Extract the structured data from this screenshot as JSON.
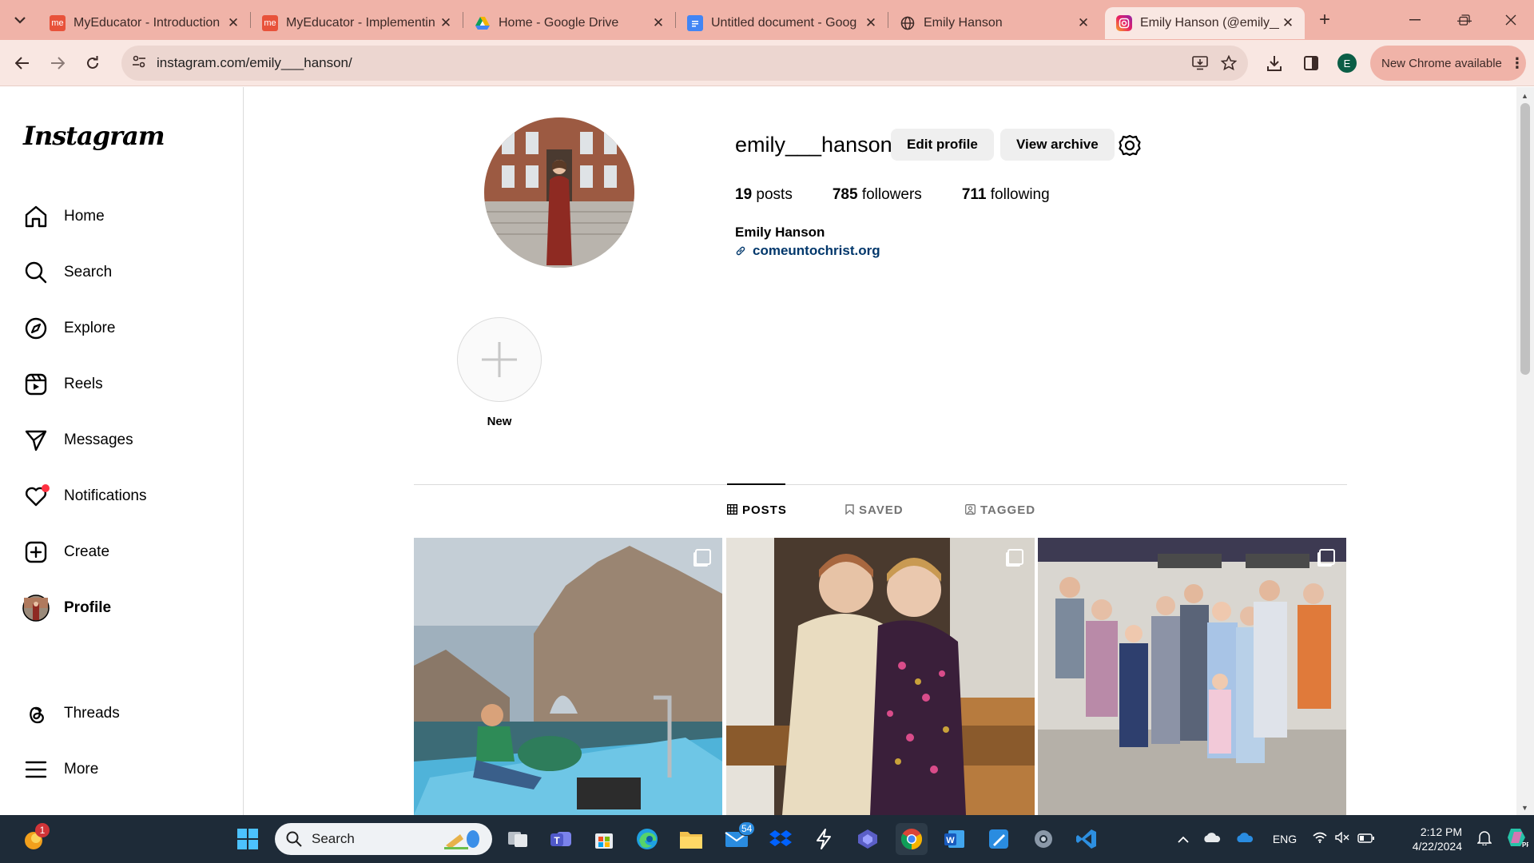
{
  "browser": {
    "tabs": [
      {
        "title": "MyEducator - Introduction",
        "favicon": "myeducator-icon",
        "color": "#e8523a"
      },
      {
        "title": "MyEducator - Implementin",
        "favicon": "myeducator-icon",
        "color": "#e8523a"
      },
      {
        "title": "Home - Google Drive",
        "favicon": "google-drive-icon"
      },
      {
        "title": "Untitled document - Goog",
        "favicon": "google-docs-icon",
        "color": "#4285f4"
      },
      {
        "title": "Emily Hanson",
        "favicon": "globe-icon"
      },
      {
        "title": "Emily Hanson (@emily__h",
        "favicon": "instagram-icon",
        "active": true
      }
    ],
    "url": "instagram.com/emily___hanson/",
    "profile_initial": "E",
    "update_label": "New Chrome available"
  },
  "sidebar": {
    "logo": "Instagram",
    "items": [
      {
        "label": "Home",
        "icon": "home-icon"
      },
      {
        "label": "Search",
        "icon": "search-icon"
      },
      {
        "label": "Explore",
        "icon": "compass-icon"
      },
      {
        "label": "Reels",
        "icon": "reels-icon"
      },
      {
        "label": "Messages",
        "icon": "messages-icon"
      },
      {
        "label": "Notifications",
        "icon": "heart-icon"
      },
      {
        "label": "Create",
        "icon": "plus-square-icon"
      },
      {
        "label": "Profile",
        "icon": "profile-avatar"
      },
      {
        "label": "Threads",
        "icon": "threads-icon"
      },
      {
        "label": "More",
        "icon": "menu-icon"
      }
    ]
  },
  "profile": {
    "username": "emily___hanson",
    "edit_label": "Edit profile",
    "archive_label": "View archive",
    "stats": {
      "posts_count": "19",
      "posts_label": "posts",
      "followers_count": "785",
      "followers_label": "followers",
      "following_count": "711",
      "following_label": "following"
    },
    "full_name": "Emily Hanson",
    "link": "comeuntochrist.org",
    "highlight_new_label": "New",
    "tabs": [
      "POSTS",
      "SAVED",
      "TAGGED"
    ],
    "active_tab": "POSTS"
  },
  "taskbar": {
    "search_placeholder": "Search",
    "mail_badge": "54",
    "notif_badge": "1",
    "language": "ENG",
    "time": "2:12 PM",
    "date": "4/22/2024"
  }
}
